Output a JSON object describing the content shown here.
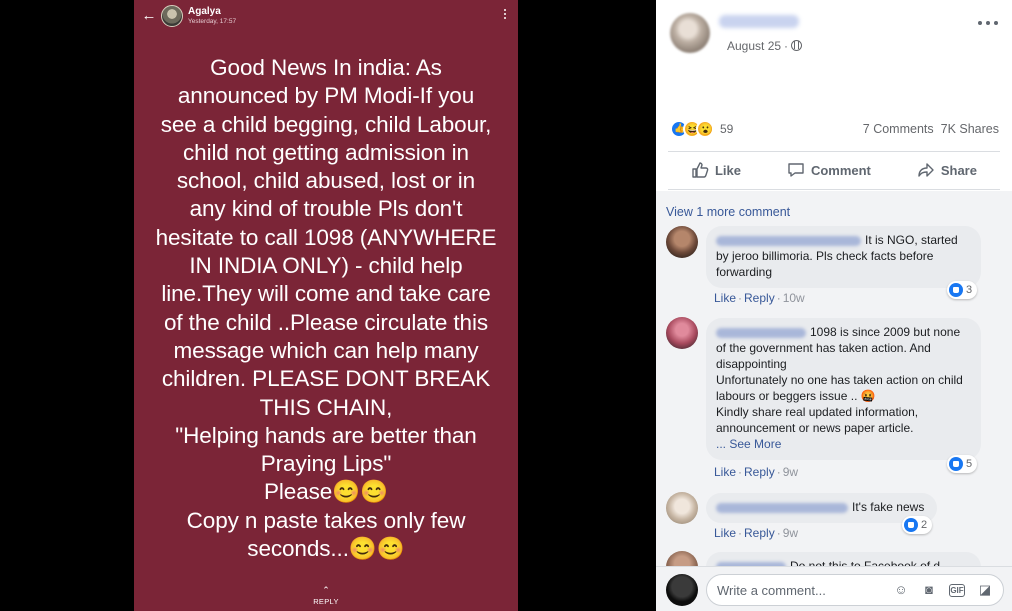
{
  "story": {
    "user_name": "Agalya",
    "timestamp": "Yesterday, 17:57",
    "text": "Good News In india: As\nannounced by PM Modi-If  you\nsee a child begging, child Labour,\nchild not getting admission in\nschool, child abused,  lost or in\nany kind of  trouble Pls don't\nhesitate to call 1098 (ANYWHERE\nIN INDIA ONLY) - child help\nline.They will come and take care\nof the child ..Please circulate this\nmessage which can help many\nchildren. PLEASE DONT BREAK\nTHIS CHAIN,\n\"Helping hands are better than\nPraying Lips\"\nPlease😊😊\nCopy n paste takes only few\nseconds...😊😊",
    "reply_label": "REPLY",
    "reply_chevron": "⌃",
    "back_icon": "←"
  },
  "post": {
    "date": "August 25",
    "dot": "·",
    "reactions": {
      "count": "59",
      "types": [
        "like-icon",
        "haha-icon",
        "wow-icon"
      ],
      "haha_glyph": "😆",
      "wow_glyph": "😮"
    },
    "comments_count": "7 Comments",
    "shares_count": "7K Shares",
    "actions": {
      "like": "Like",
      "comment": "Comment",
      "share": "Share"
    }
  },
  "comments_section": {
    "view_more": "View 1 more comment",
    "items": [
      {
        "text": "It is NGO, started by jeroo billimoria. Pls check facts before forwarding",
        "like": "Like",
        "reply": "Reply",
        "dot": "·",
        "age": "10w",
        "reactions": "3"
      },
      {
        "text": "1098 is since 2009 but none of the government has taken action. And disappointing",
        "text2": "Unfortunately no one has taken action on child labours or beggers issue .. 🤬",
        "text3": "Kindly share real updated information, announcement or news paper article.",
        "see_more": "... See More",
        "like": "Like",
        "reply": "Reply",
        "dot": "·",
        "age": "9w",
        "reactions": "5"
      },
      {
        "text": "It's fake news",
        "like": "Like",
        "reply": "Reply",
        "dot": "·",
        "age": "9w",
        "reactions": "2"
      }
    ],
    "partial_text": "Do not this to Facebook of d..."
  },
  "composer": {
    "placeholder": "Write a comment..."
  },
  "colors": {
    "story_bg": "#7b2537",
    "fb_link": "#385898",
    "fb_blue": "#1877f2",
    "comment_bg": "#f2f3f5"
  }
}
